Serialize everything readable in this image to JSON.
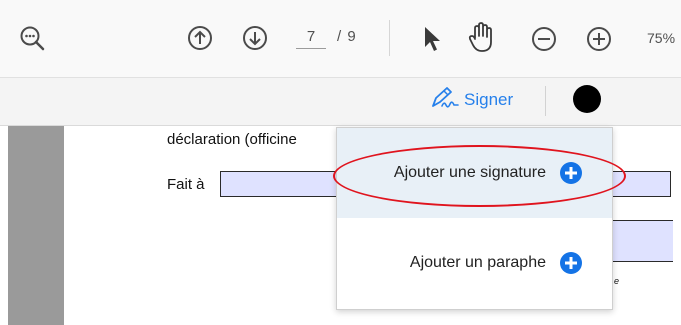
{
  "toolbar": {
    "icons": [
      "zoom-search-icon",
      "arrow-up-icon",
      "arrow-down-icon",
      "pointer-icon",
      "hand-icon",
      "zoom-out-icon",
      "zoom-in-icon"
    ],
    "page_current": "7",
    "page_total_label": "/ 9",
    "zoom_label": "75%"
  },
  "sign_bar": {
    "signer_label": "Signer",
    "signer_icon": "pen-signature-icon",
    "ink_color": "#000000"
  },
  "document": {
    "line1": "déclaration (officine",
    "line2": "Fait à",
    "tiny": "e"
  },
  "menu": {
    "items": [
      {
        "label": "Ajouter une signature",
        "icon": "add-circle-icon"
      },
      {
        "label": "Ajouter un paraphe",
        "icon": "add-circle-icon"
      }
    ]
  },
  "colors": {
    "accent": "#2680eb",
    "plus_blue": "#1473e6",
    "highlight_ellipse": "#e0141e",
    "field_fill": "#dfe2ff"
  }
}
